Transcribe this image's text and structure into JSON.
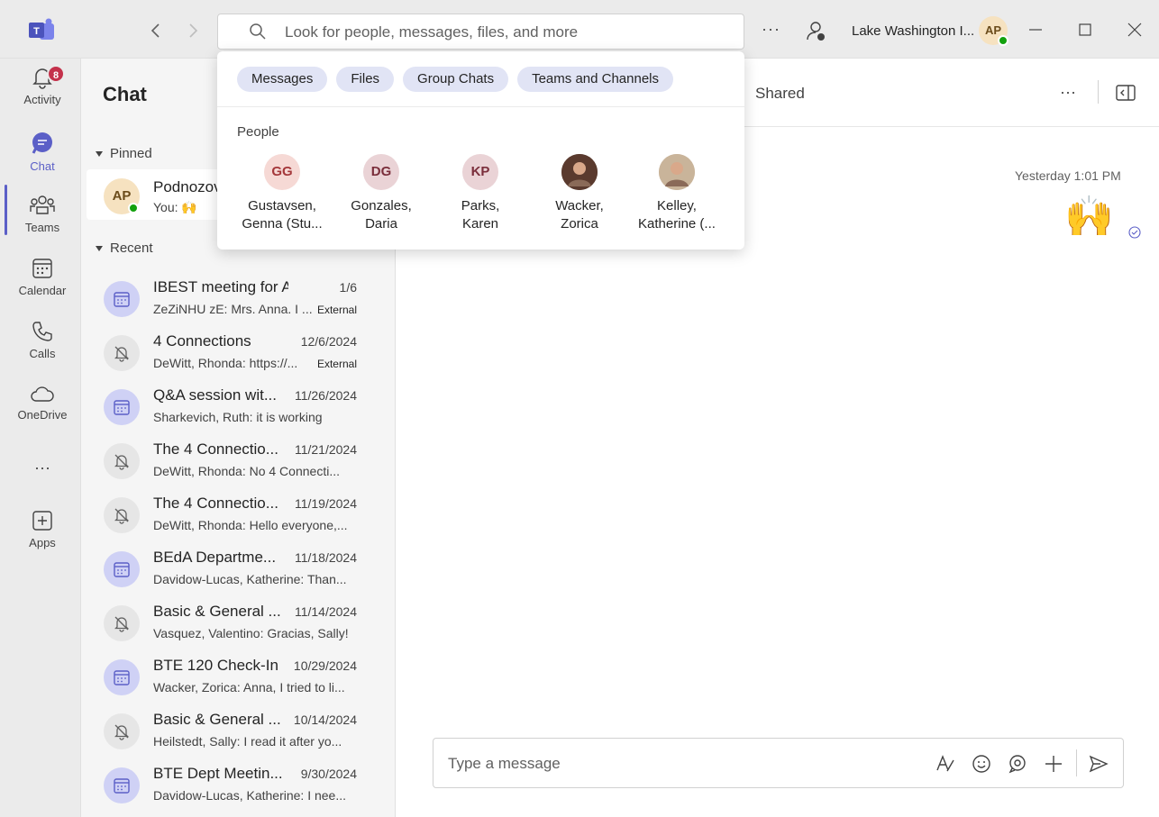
{
  "titlebar": {
    "search_placeholder": "Look for people, messages, files, and more",
    "more": "···",
    "org_name": "Lake Washington I...",
    "me_initials": "AP"
  },
  "rail": {
    "items": [
      {
        "label": "Activity",
        "icon": "bell-icon",
        "badge": "8"
      },
      {
        "label": "Chat",
        "icon": "chat-icon"
      },
      {
        "label": "Teams",
        "icon": "teams-icon"
      },
      {
        "label": "Calendar",
        "icon": "calendar-icon"
      },
      {
        "label": "Calls",
        "icon": "phone-icon"
      },
      {
        "label": "OneDrive",
        "icon": "cloud-icon"
      },
      {
        "label": "···",
        "icon": "more-icon"
      },
      {
        "label": "Apps",
        "icon": "plus-square-icon"
      }
    ]
  },
  "chatlist": {
    "title": "Chat",
    "pinned_label": "Pinned",
    "recent_label": "Recent",
    "pinned": {
      "initials": "AP",
      "name": "Podnozova",
      "preview": "You: 🙌"
    },
    "recent": [
      {
        "name": "IBEST meeting for ACCT",
        "date": "1/6",
        "preview": "ZeZiNHU zE: Mrs. Anna. I ...",
        "tag": "External",
        "type": "meeting"
      },
      {
        "name": "4 Connections",
        "date": "12/6/2024",
        "preview": "DeWitt, Rhonda: https://...",
        "tag": "External",
        "type": "muted"
      },
      {
        "name": "Q&A session wit...",
        "date": "11/26/2024",
        "preview": "Sharkevich, Ruth: it is working",
        "tag": "",
        "type": "meeting"
      },
      {
        "name": "The 4 Connectio...",
        "date": "11/21/2024",
        "preview": "DeWitt, Rhonda: No 4 Connecti...",
        "tag": "",
        "type": "muted"
      },
      {
        "name": "The 4 Connectio...",
        "date": "11/19/2024",
        "preview": "DeWitt, Rhonda: Hello everyone,...",
        "tag": "",
        "type": "muted"
      },
      {
        "name": "BEdA Departme...",
        "date": "11/18/2024",
        "preview": "Davidow-Lucas, Katherine: Than...",
        "tag": "",
        "type": "meeting"
      },
      {
        "name": "Basic & General ...",
        "date": "11/14/2024",
        "preview": "Vasquez, Valentino: Gracias, Sally!",
        "tag": "",
        "type": "muted"
      },
      {
        "name": "BTE 120 Check-In",
        "date": "10/29/2024",
        "preview": "Wacker, Zorica: Anna, I tried to li...",
        "tag": "",
        "type": "meeting"
      },
      {
        "name": "Basic & General ...",
        "date": "10/14/2024",
        "preview": "Heilstedt, Sally: I read it after yo...",
        "tag": "",
        "type": "muted"
      },
      {
        "name": "BTE Dept Meetin...",
        "date": "9/30/2024",
        "preview": "Davidow-Lucas, Katherine: I nee...",
        "tag": "",
        "type": "meeting"
      }
    ]
  },
  "main": {
    "shared_tab": "Shared",
    "more": "···",
    "message_time": "Yesterday 1:01 PM",
    "message_emoji": "🙌",
    "compose_placeholder": "Type a message"
  },
  "search_dropdown": {
    "filters": [
      "Messages",
      "Files",
      "Group Chats",
      "Teams and Channels"
    ],
    "people_label": "People",
    "people": [
      {
        "initials": "GG",
        "line1": "Gustavsen,",
        "line2": "Genna (Stu...",
        "bg": "#f6d9d5",
        "fg": "#a4373a"
      },
      {
        "initials": "DG",
        "line1": "Gonzales,",
        "line2": "Daria",
        "bg": "#ead3d6",
        "fg": "#7a2e3b"
      },
      {
        "initials": "KP",
        "line1": "Parks,",
        "line2": "Karen",
        "bg": "#ead3d6",
        "fg": "#7a2e3b"
      },
      {
        "initials": "",
        "line1": "Wacker,",
        "line2": "Zorica",
        "bg": "#5a3a2e",
        "fg": "#ffffff"
      },
      {
        "initials": "",
        "line1": "Kelley,",
        "line2": "Katherine (...",
        "bg": "#c9b49a",
        "fg": "#ffffff"
      }
    ]
  },
  "colors": {
    "accent": "#5b5fc7",
    "badge": "#c4314b",
    "presence": "#13a10e"
  }
}
